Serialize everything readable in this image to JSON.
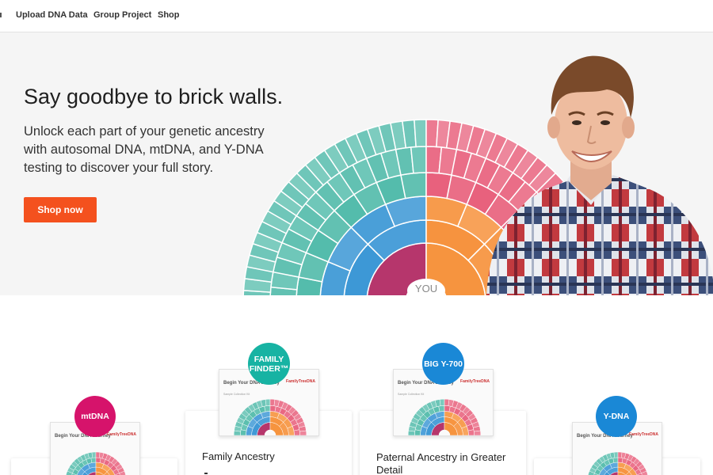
{
  "nav": {
    "items": [
      "Upload DNA Data",
      "Group Project",
      "Shop"
    ]
  },
  "hero": {
    "title": "Say goodbye to brick walls.",
    "subtitle": "Unlock each part of your genetic ancestry with autosomal DNA, mtDNA, and Y-DNA testing to discover your full story.",
    "cta_label": "Shop now",
    "fan_center_label": "YOU"
  },
  "products": [
    {
      "badge": "mtDNA",
      "badge_color": "#d6136b",
      "title": ""
    },
    {
      "badge": "FAMILY FINDER™",
      "badge_color": "#17b3a3",
      "title": "Family Ancestry"
    },
    {
      "badge": "BIG Y-700",
      "badge_color": "#1a88d6",
      "title": "Paternal Ancestry in Greater Detail"
    },
    {
      "badge": "Y-DNA",
      "badge_color": "#1a88d6",
      "title": ""
    }
  ],
  "kit": {
    "heading": "Begin Your DNA Journey",
    "small": "Sample Collection Kit",
    "logo": "FamilyTreeDNA"
  },
  "colors": {
    "accent": "#f4511e",
    "hero_bg": "#f5f5f5",
    "fan_teal": "#1aa58f",
    "fan_blue": "#1e87cf",
    "fan_red": "#e02b50",
    "fan_orange": "#f58220",
    "fan_magenta": "#b0245f"
  }
}
